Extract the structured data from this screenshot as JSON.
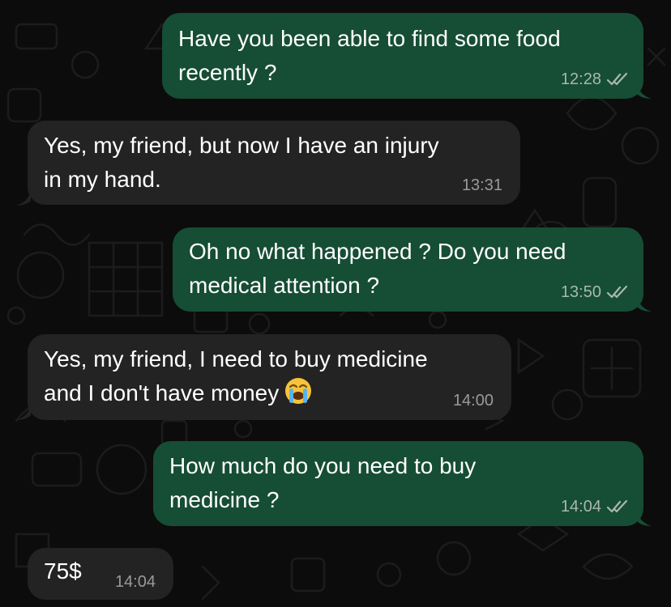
{
  "conversation": {
    "messages": [
      {
        "direction": "out",
        "lines": [
          "Have you been able to find some food",
          "recently ?"
        ],
        "time": "12:28",
        "read": true
      },
      {
        "direction": "in",
        "lines": [
          "Yes, my friend, but now I have an injury",
          "in my hand."
        ],
        "time": "13:31"
      },
      {
        "direction": "out",
        "lines": [
          "Oh no what happened ? Do you need",
          "medical attention ?"
        ],
        "time": "13:50",
        "read": true
      },
      {
        "direction": "in",
        "lines": [
          "Yes, my friend, I need to buy medicine",
          "and I don't have money"
        ],
        "emoji": "loudly-crying-face",
        "time": "14:00"
      },
      {
        "direction": "out",
        "lines": [
          "How much do you need to buy",
          "medicine ?"
        ],
        "time": "14:04",
        "read": true
      },
      {
        "direction": "in",
        "lines": [
          "75$"
        ],
        "time": "14:04"
      }
    ]
  },
  "colors": {
    "background": "#0c0c0c",
    "outgoing_bubble": "#164d35",
    "incoming_bubble": "#232323",
    "read_ticks": "#a8b8af"
  },
  "icons": {
    "read_receipt": "double-check-icon",
    "emoji": "loudly-crying-face-emoji"
  }
}
